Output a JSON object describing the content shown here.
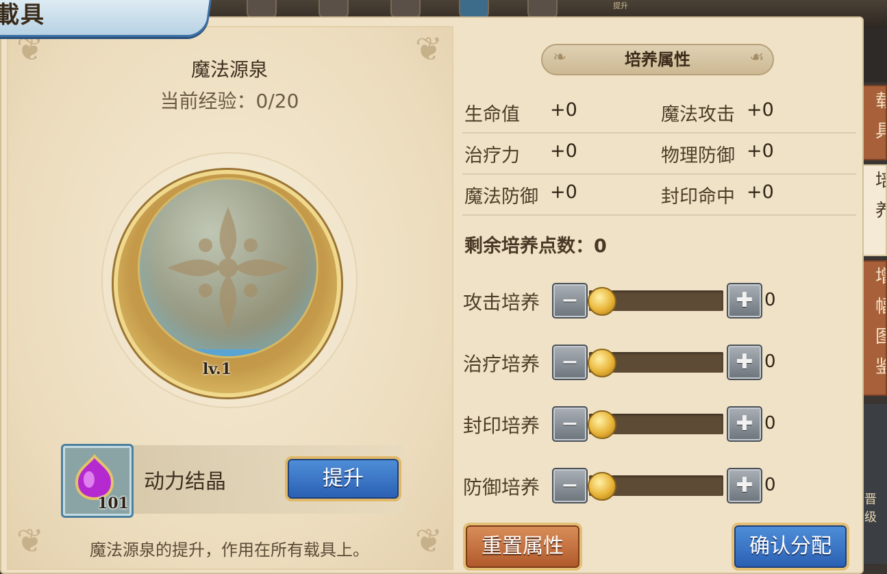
{
  "window": {
    "title": "載具",
    "top_bar_small_text": "提升"
  },
  "left": {
    "item_title": "魔法源泉",
    "exp_text": "当前经验：0/20",
    "level": "lv.1",
    "material": {
      "name": "动力结晶",
      "count": "101",
      "icon": "purple-crystal-icon"
    },
    "upgrade_label": "提升",
    "description": "魔法源泉的提升，作用在所有载具上。"
  },
  "right": {
    "section_title": "培养属性",
    "attributes": [
      {
        "name": "生命值",
        "value": "+0"
      },
      {
        "name": "魔法攻击",
        "value": "+0"
      },
      {
        "name": "治疗力",
        "value": "+0"
      },
      {
        "name": "物理防御",
        "value": "+0"
      },
      {
        "name": "魔法防御",
        "value": "+0"
      },
      {
        "name": "封印命中",
        "value": "+0"
      }
    ],
    "remaining_points": "剩余培养点数：0",
    "training": [
      {
        "label": "攻击培养",
        "value": "0",
        "fraction": 0
      },
      {
        "label": "治疗培养",
        "value": "0",
        "fraction": 0
      },
      {
        "label": "封印培养",
        "value": "0",
        "fraction": 0
      },
      {
        "label": "防御培养",
        "value": "0",
        "fraction": 0
      }
    ],
    "reset_label": "重置属性",
    "confirm_label": "确认分配"
  },
  "side_tabs": [
    {
      "label": "载具"
    },
    {
      "label": "培养"
    },
    {
      "label": "增幅图鉴"
    }
  ],
  "side_small_text": "晋级",
  "colors": {
    "panel_bg": "#efe2c6",
    "accent_blue": "#2a5fb2",
    "accent_orange": "#b0582a",
    "gold": "#e8b438",
    "text_brown": "#4d3c28"
  }
}
